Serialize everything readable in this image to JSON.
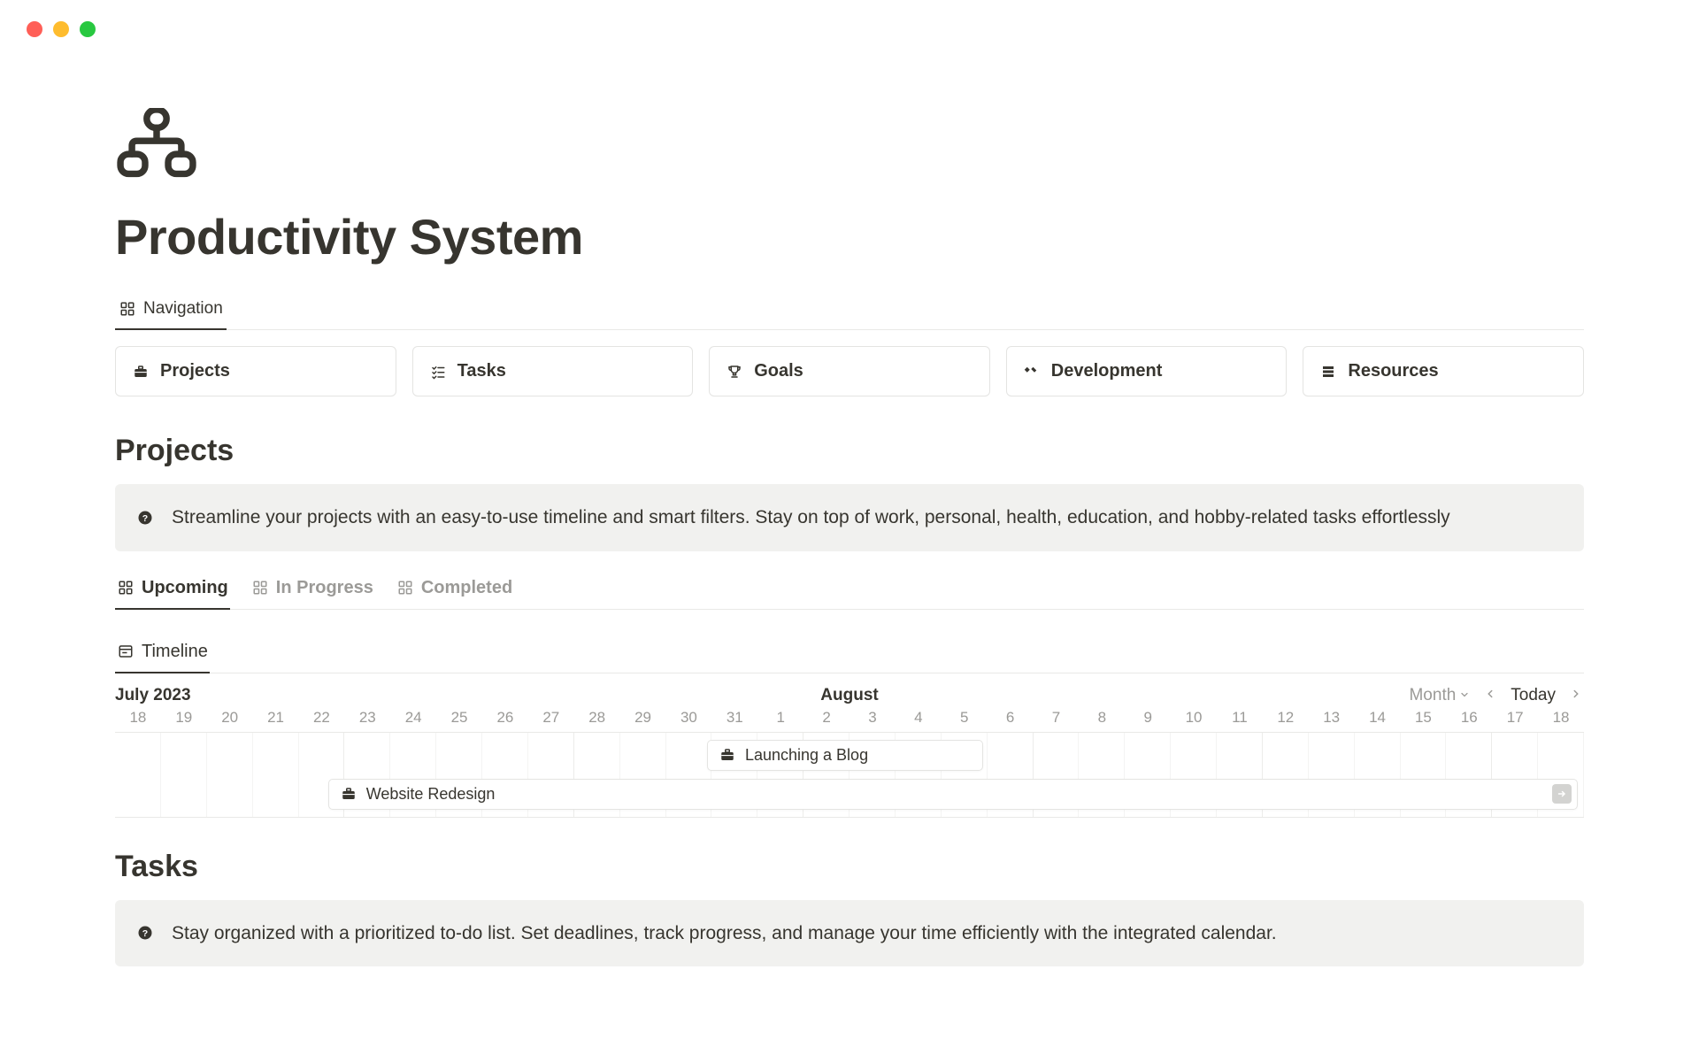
{
  "window": {
    "traffic_lights": [
      "close",
      "minimize",
      "zoom"
    ]
  },
  "page": {
    "title": "Productivity System",
    "icon": "sitemap-icon"
  },
  "navigation_tab": {
    "label": "Navigation"
  },
  "nav_cards": [
    {
      "label": "Projects",
      "icon": "briefcase-icon"
    },
    {
      "label": "Tasks",
      "icon": "checklist-icon"
    },
    {
      "label": "Goals",
      "icon": "trophy-icon"
    },
    {
      "label": "Development",
      "icon": "tools-icon"
    },
    {
      "label": "Resources",
      "icon": "stack-icon"
    }
  ],
  "projects": {
    "section_title": "Projects",
    "callout": "Streamline your projects with an easy-to-use timeline and smart filters. Stay on top of work, personal, health, education, and hobby-related tasks effortlessly",
    "view_tabs": [
      {
        "label": "Upcoming",
        "active": true
      },
      {
        "label": "In Progress",
        "active": false
      },
      {
        "label": "Completed",
        "active": false
      }
    ],
    "timeline_tab_label": "Timeline",
    "timeline": {
      "primary_month": "July 2023",
      "secondary_month": "August",
      "scale_label": "Month",
      "today_label": "Today",
      "days": [
        "18",
        "19",
        "20",
        "21",
        "22",
        "23",
        "24",
        "25",
        "26",
        "27",
        "28",
        "29",
        "30",
        "31",
        "1",
        "2",
        "3",
        "4",
        "5",
        "6",
        "7",
        "8",
        "9",
        "10",
        "11",
        "12",
        "13",
        "14",
        "15",
        "16",
        "17",
        "18"
      ],
      "bars": [
        {
          "label": "Launching a Blog",
          "icon": "briefcase-icon"
        },
        {
          "label": "Website Redesign",
          "icon": "briefcase-icon",
          "continues_right": true
        }
      ]
    }
  },
  "tasks": {
    "section_title": "Tasks",
    "callout": "Stay organized with a prioritized to-do list. Set deadlines, track progress, and manage your time efficiently with the integrated calendar."
  }
}
